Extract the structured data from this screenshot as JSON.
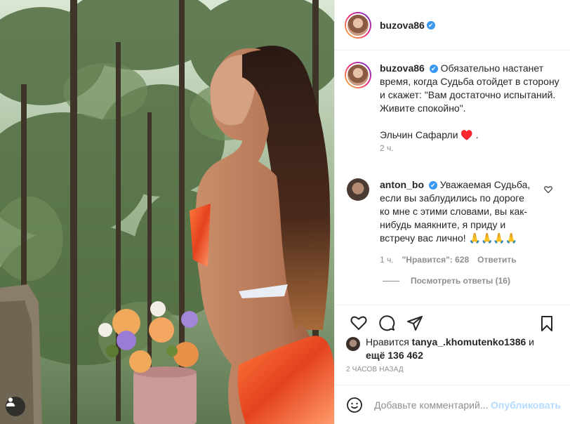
{
  "header": {
    "username": "buzova86",
    "verified": "✔"
  },
  "caption": {
    "username": "buzova86",
    "verified": "✔",
    "line1": "Обязательно настанет время, когда Судьба отойдет в сторону и скажет: \"Вам достаточно испытаний. Живите спокойно\".",
    "line2": "Эльчин Сафарли ♥️ .",
    "time": "2 ч."
  },
  "comment": {
    "username": "anton_bo",
    "verified": "✔",
    "text": "Уважаемая Судьба, если вы заблудились по дороге ко мне с этими словами, вы как-нибудь маякните, я приду и встречу вас лично! 🙏🙏🙏🙏",
    "time": "1 ч.",
    "likes": "\"Нравится\": 628",
    "reply": "Ответить",
    "view_replies": "Посмотреть ответы (16)"
  },
  "likes": {
    "prefix": "Нравится ",
    "user": "tanya_.khomutenko1386",
    "and": " и",
    "others": "ещё 136 462"
  },
  "date": "2 ЧАСОВ НАЗАД",
  "add_comment": {
    "placeholder": "Добавьте комментарий...",
    "publish": "Опубликовать"
  },
  "icons": {
    "like": "heart-icon",
    "comment": "comment-icon",
    "share": "share-icon",
    "save": "bookmark-icon",
    "emoji": "emoji-icon",
    "tag": "user-tag-icon"
  },
  "colors": {
    "verified": "#3897f0",
    "publish_disabled": "#b3dbff",
    "muted": "#8e8e8e",
    "text": "#262626"
  }
}
